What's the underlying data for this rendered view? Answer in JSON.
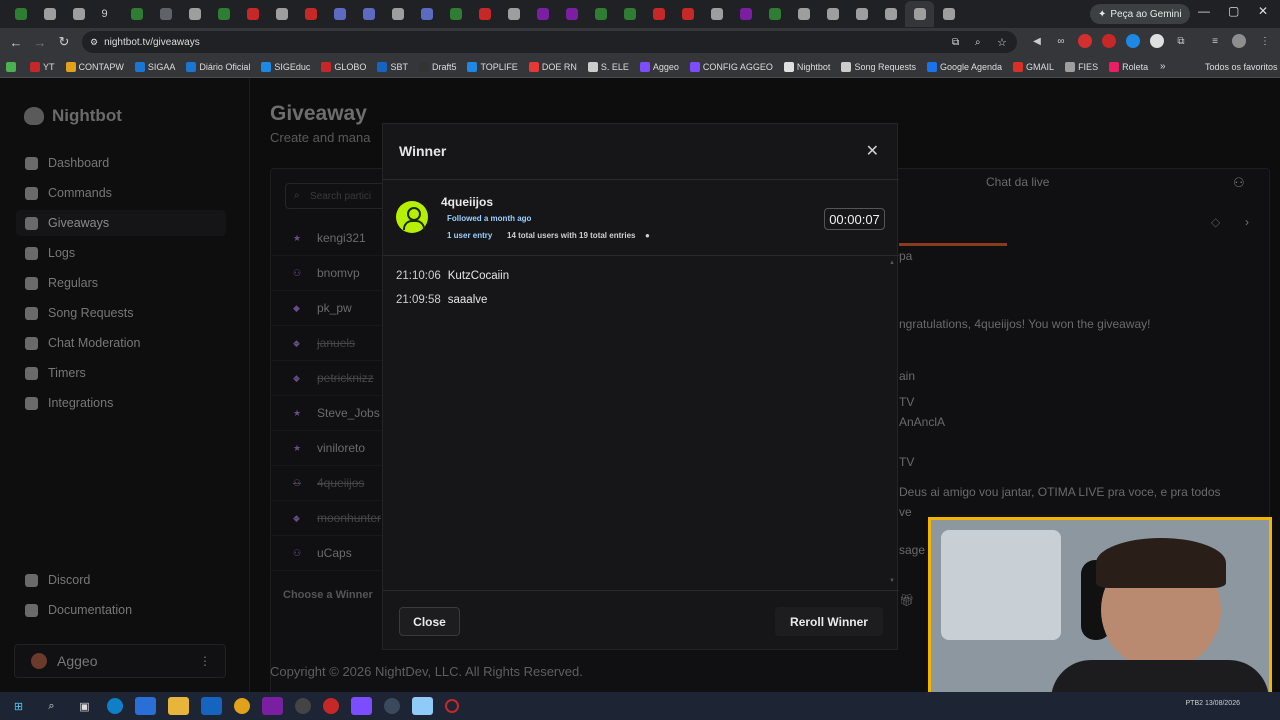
{
  "browser": {
    "url": "nightbot.tv/giveaways",
    "gemini_label": "Peça ao Gemini",
    "tabs": [
      "",
      "",
      "",
      "9",
      "",
      "",
      "",
      "",
      "",
      "",
      "",
      "",
      "",
      "",
      "",
      "",
      "",
      "",
      "",
      "",
      "",
      "",
      "",
      "",
      "",
      "",
      "",
      "",
      "",
      "",
      "",
      "",
      ""
    ],
    "bookmarks": [
      "",
      "YT",
      "CONTAPW",
      "SIGAA",
      "Diário Oficial",
      "SIGEduc",
      "GLOBO",
      "SBT",
      "Draft5",
      "TOPLIFE",
      "DOE RN",
      "S. ELE",
      "Aggeo",
      "CONFIG AGGEO",
      "Nightbot",
      "Song Requests",
      "Google Agenda",
      "GMAIL",
      "FIES",
      "Roleta"
    ],
    "all_bookmarks": "Todos os favoritos"
  },
  "sidebar": {
    "brand": "Nightbot",
    "items": [
      {
        "label": "Dashboard",
        "active": false
      },
      {
        "label": "Commands",
        "active": false
      },
      {
        "label": "Giveaways",
        "active": true
      },
      {
        "label": "Logs",
        "active": false
      },
      {
        "label": "Regulars",
        "active": false
      },
      {
        "label": "Song Requests",
        "active": false
      },
      {
        "label": "Chat Moderation",
        "active": false
      },
      {
        "label": "Timers",
        "active": false
      },
      {
        "label": "Integrations",
        "active": false
      }
    ],
    "bottom_items": [
      "Discord",
      "Documentation"
    ],
    "user": "Aggeo"
  },
  "main": {
    "title": "Giveaway",
    "subtitle": "Create and mana",
    "search_placeholder": "Search partici",
    "entrants": [
      {
        "name": "kengi321",
        "icon": "star",
        "dim": false
      },
      {
        "name": "bnomvp",
        "icon": "users",
        "dim": false
      },
      {
        "name": "pk_pw",
        "icon": "gem",
        "dim": false
      },
      {
        "name": "januels",
        "icon": "gem",
        "dim": true
      },
      {
        "name": "petricknizz",
        "icon": "gem",
        "dim": true
      },
      {
        "name": "Steve_Jobs",
        "icon": "star",
        "dim": false
      },
      {
        "name": "viniloreto",
        "icon": "star",
        "dim": false
      },
      {
        "name": "4queiijos",
        "icon": "users",
        "dim": true
      },
      {
        "name": "moonhunter",
        "icon": "gem",
        "dim": true
      },
      {
        "name": "uCaps",
        "icon": "users",
        "dim": false
      }
    ],
    "choose_winner": "Choose a Winner",
    "chat_title": "Chat da live",
    "chat_lines": [
      {
        "text": "pa",
        "boxed": true
      },
      {
        "text": "ngratulations, 4queiijos! You won the giveaway!",
        "boxed": false
      },
      {
        "text": "ain",
        "boxed": false
      },
      {
        "text": "TV",
        "boxed": true
      },
      {
        "text": "AnAnclA",
        "boxed": true
      },
      {
        "text": "TV",
        "boxed": true
      },
      {
        "text": "Deus ai amigo vou jantar, OTIMA LIVE pra voce, e pra todos",
        "boxed": true
      },
      {
        "text": "ve",
        "boxed": true
      },
      {
        "text": "sage",
        "boxed": false
      }
    ],
    "footer": "Copyright © 2026 NightDev, LLC. All Rights Reserved."
  },
  "modal": {
    "title": "Winner",
    "winner_name": "4queiijos",
    "followed": "Followed a month ago",
    "user_entry": "1 user entry",
    "totals": "14 total users with 19 total entries",
    "timer": "00:00:07",
    "messages": [
      {
        "time": "21:10:06",
        "user": "KutzCocaiin"
      },
      {
        "time": "21:09:58",
        "user": "saaalve"
      }
    ],
    "close_label": "Close",
    "reroll_label": "Reroll Winner"
  },
  "taskbar": {
    "tray_text": "PTB2  13/08/2026"
  },
  "colors": {
    "winner_avatar": "#b6f000",
    "follow_text": "#9bd0ff",
    "webcam_border": "#f2b600"
  }
}
